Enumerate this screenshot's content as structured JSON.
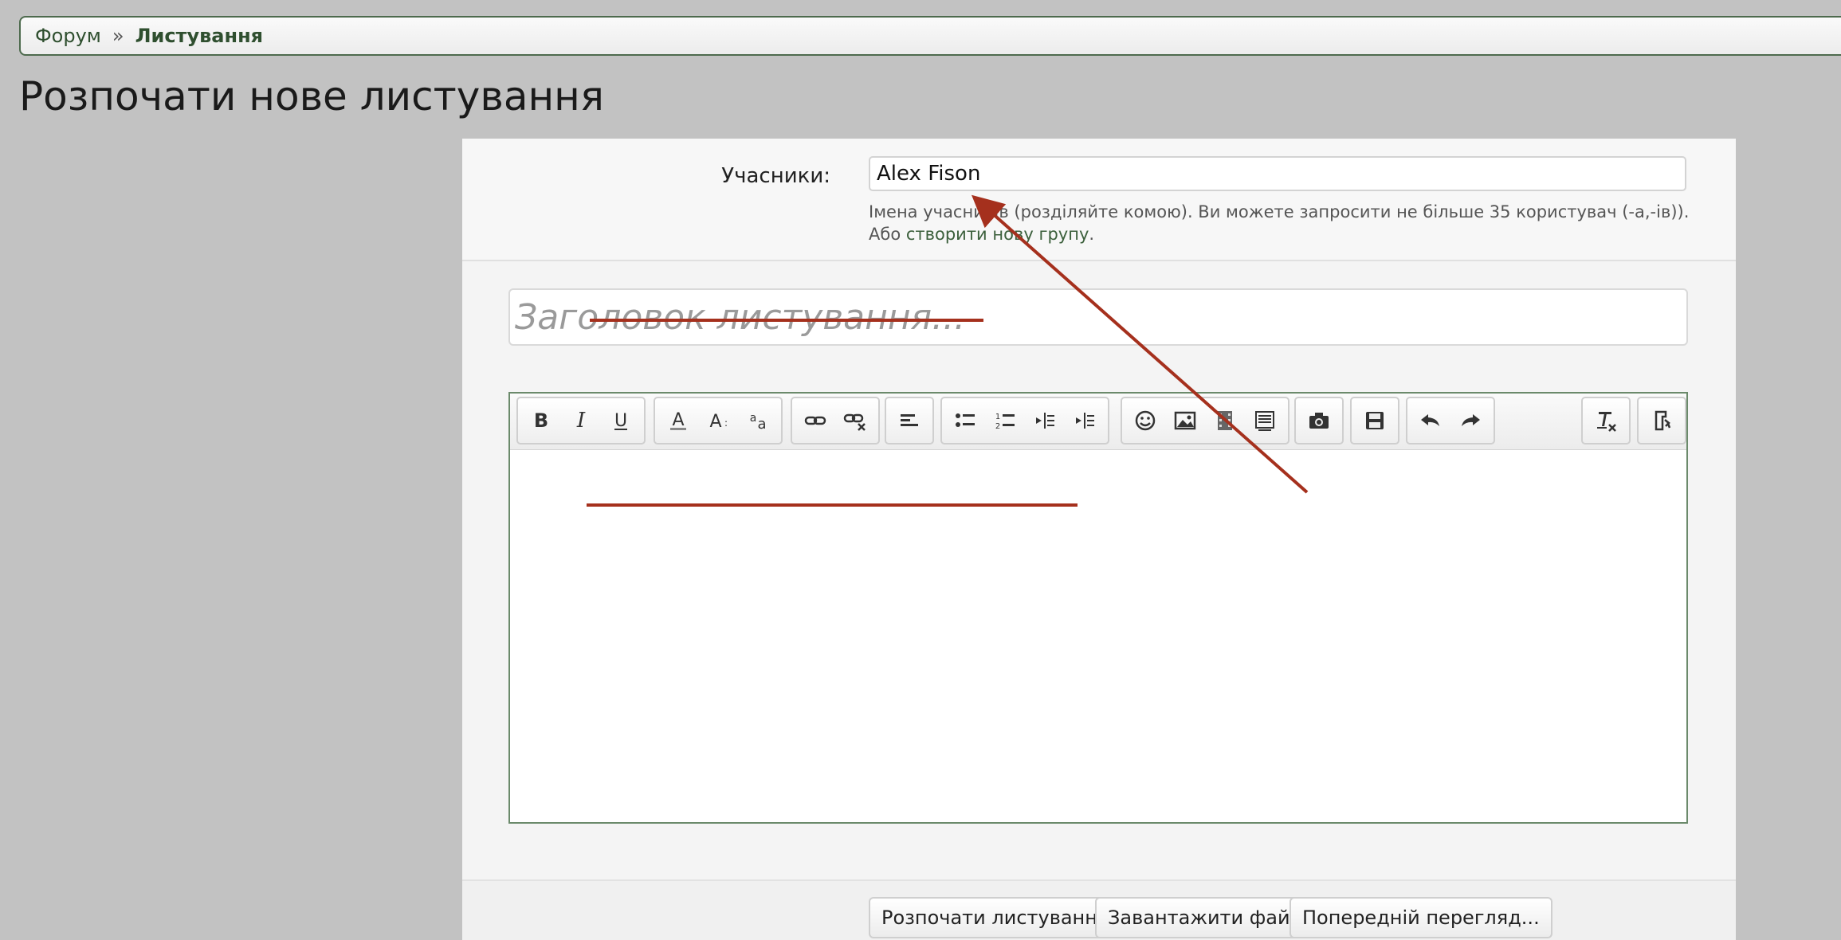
{
  "breadcrumb": {
    "forum": "Форум",
    "separator": "»",
    "current": "Листування"
  },
  "page": {
    "title": "Розпочати нове листування"
  },
  "participants": {
    "label": "Учасники:",
    "value": "Alex Fison",
    "hint": "Імена учасників (розділяйте комою). Ви можете запросити не більше 35 користувач (-а,-ів)). Або ",
    "hint_link": "створити нову групу",
    "hint_end": "."
  },
  "conversation": {
    "title_placeholder": "Заголовок листування..."
  },
  "toolbar": {
    "icons": [
      "bold-icon",
      "italic-icon",
      "underline-icon",
      "text-color-icon",
      "font-size-icon",
      "font-family-icon",
      "link-icon",
      "unlink-icon",
      "align-icon",
      "bullet-list-icon",
      "numbered-list-icon",
      "outdent-icon",
      "indent-icon",
      "smiley-icon",
      "image-icon",
      "media-icon",
      "quote-icon",
      "camera-icon",
      "save-draft-icon",
      "undo-icon",
      "redo-icon",
      "remove-format-icon",
      "toggle-bbcode-icon"
    ]
  },
  "actions": {
    "start": "Розпочати листування",
    "upload": "Завантажити файл",
    "preview": "Попередній перегляд..."
  },
  "colors": {
    "accent": "#2f4f2f",
    "annotation": "#a5301d"
  }
}
